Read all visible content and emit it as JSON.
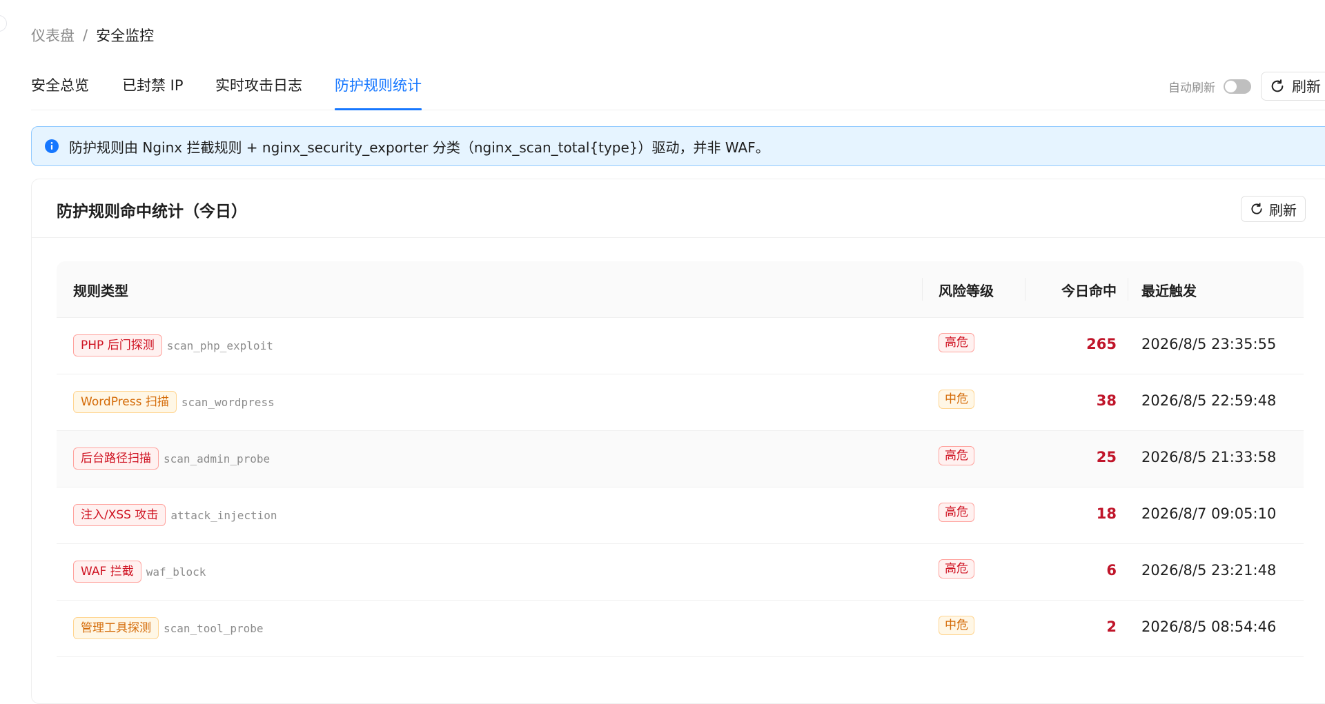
{
  "breadcrumb": {
    "parent": "仪表盘",
    "separator": "/",
    "current": "安全监控"
  },
  "tabs": [
    {
      "label": "安全总览"
    },
    {
      "label": "已封禁 IP"
    },
    {
      "label": "实时攻击日志"
    },
    {
      "label": "防护规则统计",
      "active": true
    }
  ],
  "toolbar": {
    "auto_refresh_label": "自动刷新",
    "auto_refresh_on": false,
    "refresh_label": "刷新"
  },
  "alert": {
    "icon": "info-icon",
    "text": "防护规则由 Nginx 拦截规则 + nginx_security_exporter 分类（nginx_scan_total{type}）驱动，并非 WAF。"
  },
  "card": {
    "title": "防护规则命中统计（今日）",
    "refresh_label": "刷新",
    "columns": {
      "rule": "规则类型",
      "risk": "风险等级",
      "hits": "今日命中",
      "last": "最近触发"
    },
    "rows": [
      {
        "tag": "PHP 后门探测",
        "code": "scan_php_exploit",
        "risk": "高危",
        "hits": "265",
        "last": "2026/8/5 23:35:55"
      },
      {
        "tag": "WordPress 扫描",
        "code": "scan_wordpress",
        "risk": "中危",
        "hits": "38",
        "last": "2026/8/5 22:59:48"
      },
      {
        "tag": "后台路径扫描",
        "code": "scan_admin_probe",
        "risk": "高危",
        "hits": "25",
        "last": "2026/8/5 21:33:58"
      },
      {
        "tag": "注入/XSS 攻击",
        "code": "attack_injection",
        "risk": "高危",
        "hits": "18",
        "last": "2026/8/7 09:05:10"
      },
      {
        "tag": "WAF 拦截",
        "code": "waf_block",
        "risk": "高危",
        "hits": "6",
        "last": "2026/8/5 23:21:48"
      },
      {
        "tag": "管理工具探测",
        "code": "scan_tool_probe",
        "risk": "中危",
        "hits": "2",
        "last": "2026/8/5 08:54:46"
      }
    ]
  },
  "colors": {
    "accent": "#1677ff",
    "high_risk": "#cf1322",
    "medium_risk": "#d46b08",
    "hit_count": "#c0152a",
    "alert_bg": "#e6f4ff"
  }
}
